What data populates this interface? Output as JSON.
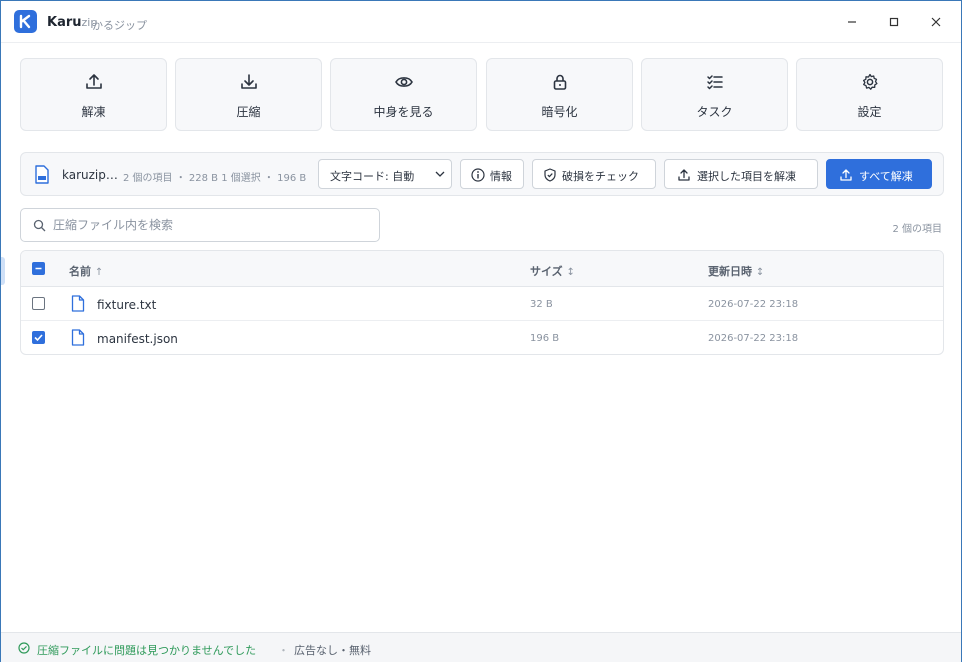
{
  "window": {
    "app_name": "Karu",
    "app_name_suffix": "zip",
    "subtitle": "かるジップ",
    "colors": {
      "accent": "#2f6fdc",
      "ok": "#2f9a5a"
    }
  },
  "toolbar": {
    "tiles": [
      {
        "label": "解凍",
        "icon": "upload-icon"
      },
      {
        "label": "圧縮",
        "icon": "download-icon"
      },
      {
        "label": "中身を見る",
        "icon": "eye-icon"
      },
      {
        "label": "暗号化",
        "icon": "lock-icon"
      },
      {
        "label": "タスク",
        "icon": "list-check-icon"
      },
      {
        "label": "設定",
        "icon": "gear-icon"
      }
    ]
  },
  "archive": {
    "name": "karuzip…",
    "meta": "2 個の項目 ・ 228 B  1 個選択 ・ 196 B",
    "encoding_label": "文字コード: 自動",
    "info_label": "情報",
    "check_label": "破損をチェック",
    "extract_selected_label": "選択した項目を解凍",
    "extract_all_label": "すべて解凍"
  },
  "search": {
    "placeholder": "圧縮ファイル内を検索",
    "value": ""
  },
  "item_count": "2 個の項目",
  "table": {
    "headers": {
      "name": "名前",
      "name_sort": "↑",
      "size": "サイズ",
      "size_sort": "↕",
      "modified": "更新日時",
      "modified_sort": "↕"
    },
    "rows": [
      {
        "name": "fixture.txt",
        "size": "32 B",
        "modified": "2026-07-22 23:18",
        "checked": false
      },
      {
        "name": "manifest.json",
        "size": "196 B",
        "modified": "2026-07-22 23:18",
        "checked": true
      }
    ]
  },
  "status": {
    "message": "圧縮ファイルに問題は見つかりませんでした",
    "separator": "・",
    "ad_text": "広告なし・無料"
  }
}
